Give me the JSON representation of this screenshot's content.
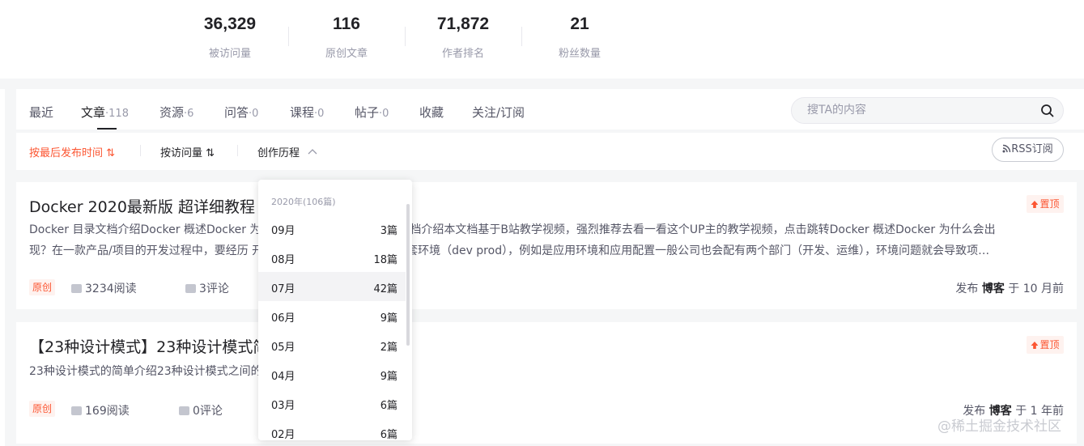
{
  "stats": [
    {
      "value": "36,329",
      "label": "被访问量"
    },
    {
      "value": "116",
      "label": "原创文章"
    },
    {
      "value": "71,872",
      "label": "作者排名"
    },
    {
      "value": "21",
      "label": "粉丝数量"
    }
  ],
  "tabs": [
    {
      "label": "最近",
      "count": ""
    },
    {
      "label": "文章",
      "count": "·118"
    },
    {
      "label": "资源",
      "count": "·6"
    },
    {
      "label": "问答",
      "count": "·0"
    },
    {
      "label": "课程",
      "count": "·0"
    },
    {
      "label": "帖子",
      "count": "·0"
    },
    {
      "label": "收藏",
      "count": ""
    },
    {
      "label": "关注/订阅",
      "count": ""
    }
  ],
  "search": {
    "placeholder": "搜TA的内容"
  },
  "filters": {
    "by_publish": "按最后发布时间 ⇅",
    "by_visits": "按访问量 ⇅",
    "history": "创作历程",
    "rss": "RSS订阅"
  },
  "articles": [
    {
      "title": "Docker 2020最新版 超详细教程",
      "desc_line1": "Docker 目录文档介绍Docker 概述Docker 为什么会出现 Docker 的历史文档介绍本文档基于B站教学视频，强烈推荐去看一看这个UP主的教学视频，点击跳转Docker 概述Docker 为什么会出",
      "desc_line2": "现？在一款产品/项目的开发过程中，要经历 开发 上线 两套环境，就会有两套环境（dev prod），例如是应用环境和应用配置一般公司也会配有两个部门（开发、运维），环境问题就会导致项…",
      "pin": "置顶",
      "original": "原创",
      "reads": "3234阅读",
      "comments": "3评论",
      "pub_prefix": "发布",
      "pub_who": "博客",
      "pub_suffix": "于 10 月前"
    },
    {
      "title": "【23种设计模式】23种设计模式简介",
      "desc_line1": "23种设计模式的简单介绍23种设计模式之间的关系",
      "pin": "置顶",
      "original": "原创",
      "reads": "169阅读",
      "comments": "0评论",
      "pub_prefix": "发布",
      "pub_who": "博客",
      "pub_suffix": "于 1 年前"
    }
  ],
  "dropdown": {
    "year_header": "2020年(106篇)",
    "months": [
      {
        "month": "09月",
        "count": "3篇"
      },
      {
        "month": "08月",
        "count": "18篇"
      },
      {
        "month": "07月",
        "count": "42篇"
      },
      {
        "month": "06月",
        "count": "9篇"
      },
      {
        "month": "05月",
        "count": "2篇"
      },
      {
        "month": "04月",
        "count": "9篇"
      },
      {
        "month": "03月",
        "count": "6篇"
      },
      {
        "month": "02月",
        "count": "6篇"
      }
    ],
    "highlighted": "07月"
  },
  "watermark": "@稀土掘金技术社区",
  "colors": {
    "accent": "#fc5531",
    "text": "#222226",
    "muted": "#999aaa"
  }
}
